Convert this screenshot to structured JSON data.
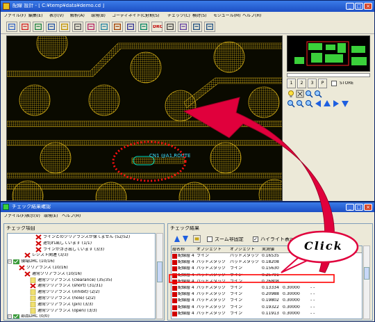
{
  "main_window": {
    "title": "配線 設計 - [ C:¥temp¥data¥demo.cd ]",
    "menu": [
      "ファイル(F)",
      "編集(E)",
      "表示(V)",
      "解析(A)",
      "環境(B)",
      "コーディネイト(C)",
      "分割(S)",
      "チェック(C)",
      "検討(S)",
      "モジュール(M)",
      "ヘルプ(H)"
    ],
    "toolbar_icons": [
      "open-icon",
      "edit-icon",
      "layer-icon",
      "net-icon",
      "check-icon",
      "grid-icon",
      "route-icon",
      "via-icon",
      "pad-icon",
      "split-icon",
      "arrow-icon",
      "drc-icon",
      "zoom-icon",
      "measure-icon",
      "undo-icon",
      "redo-icon"
    ],
    "drc_label": "DRC",
    "highlight_label": "CN1 @A1,ROUTE",
    "side_panel": {
      "layer_buttons": [
        "1",
        "2",
        "3",
        "P"
      ],
      "store_label": "STORE",
      "nav_icons": [
        "bulb-icon",
        "select-icon",
        "zoom-fit-icon",
        "zoom-out-icon",
        "zoom-in-icon",
        "zoom-area-icon",
        "zoom-prev-icon",
        "arrow-left-icon",
        "arrow-up-icon",
        "arrow-right-icon",
        "arrow-down-icon"
      ]
    }
  },
  "check_window": {
    "title": "チェック結果確認",
    "menu": [
      "ファイル(F)",
      "表示(V)",
      "環境(E)",
      "ヘルプ(H)"
    ],
    "tree_header": "チェック項目",
    "tree_items": [
      {
        "label": "ラインとのクリアランスが保てません (52/52)",
        "indent": 5,
        "icon": "x"
      },
      {
        "label": "途切れ出しています (1/1)",
        "indent": 5,
        "icon": "x"
      },
      {
        "label": "ラインが浮き出しています (3/3)",
        "indent": 5,
        "icon": "x"
      },
      {
        "label": "レジスト関連 (3/3)",
        "indent": 3,
        "icon": "x"
      },
      {
        "label": "領域DRC (10/16)",
        "indent": 1,
        "icon": "folder"
      },
      {
        "label": "クリアランス (10/16)",
        "indent": 2,
        "icon": "x"
      },
      {
        "label": "通常クリアランス (10/16)",
        "indent": 3,
        "icon": "x"
      },
      {
        "label": "通常クリアランス (clearance) (35/35)",
        "indent": 4,
        "icon": "doc"
      },
      {
        "label": "通常クリアランス (short) (31/31)",
        "indent": 4,
        "icon": "x"
      },
      {
        "label": "通常クリアランス (inhibit) (2/2)",
        "indent": 4,
        "icon": "doc"
      },
      {
        "label": "通常クリアランス (hole) (2/2)",
        "indent": 4,
        "icon": "doc"
      },
      {
        "label": "通常クリアランス (pin) (3/3)",
        "indent": 4,
        "icon": "doc"
      },
      {
        "label": "通常クリアランス (open) (3/3)",
        "indent": 4,
        "icon": "doc"
      },
      {
        "label": "部品DRC (0/0)",
        "indent": 1,
        "icon": "folder"
      }
    ],
    "results_header": "チェック結果",
    "zoom_label": "ズーム非固定",
    "highlight_label": "ハイライト表示",
    "columns": [
      "層名称",
      "オブジェクト",
      "オブジェクト",
      "実測値"
    ],
    "rows": [
      {
        "layer": "配線層 4",
        "obj1": "ライン",
        "obj2": "パッドスタック",
        "measured": "0.16535"
      },
      {
        "layer": "配線層 4",
        "obj1": "パッドスタック",
        "obj2": "パッドスタック",
        "measured": "0.18208"
      },
      {
        "layer": "配線層 4",
        "obj1": "パッドスタック",
        "obj2": "ライン",
        "measured": "0.15630"
      },
      {
        "layer": "配線層 4",
        "obj1": "パッドスタック",
        "obj2": "ライン",
        "measured": "0.25791"
      },
      {
        "layer": "配線層 4",
        "obj1": "パッドスタック",
        "obj2": "ライン",
        "measured": "0.26808"
      },
      {
        "layer": "配線層 4",
        "obj1": "パッドスタック",
        "obj2": "ライン",
        "measured": "0.13334",
        "limit": "0.30000",
        "extra": "- -"
      },
      {
        "layer": "配線層 4",
        "obj1": "パッドスタック",
        "obj2": "ライン",
        "measured": "0.20988",
        "limit": "0.30000",
        "extra": "- -"
      },
      {
        "layer": "配線層 4",
        "obj1": "パッドスタック",
        "obj2": "ライン",
        "measured": "0.19802",
        "limit": "0.30000",
        "extra": "- -"
      },
      {
        "layer": "配線層 4",
        "obj1": "パッドスタック",
        "obj2": "ライン",
        "measured": "0.19322",
        "limit": "0.30000",
        "extra": "- -"
      },
      {
        "layer": "配線層 4",
        "obj1": "パッドスタック",
        "obj2": "ライン",
        "measured": "0.11913",
        "limit": "0.30000",
        "extra": "- -"
      }
    ],
    "selected_row": 5
  },
  "callout": "Click",
  "colors": {
    "pcb_bg": "#0a0a00",
    "trace": "#c8a414",
    "highlight": "#ff0000",
    "titlebar": "#2a5bd7",
    "accent_arrow": "#e0003c"
  }
}
